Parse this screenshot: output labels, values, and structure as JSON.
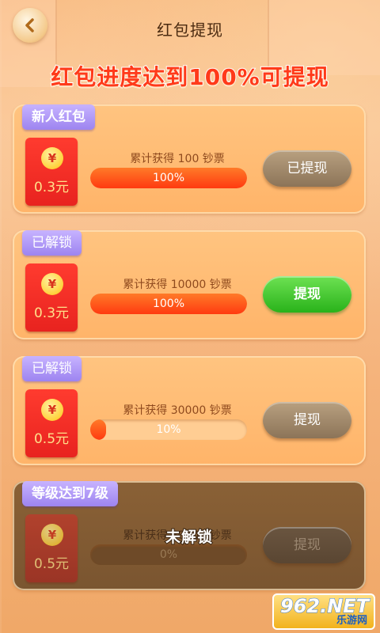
{
  "header": {
    "title": "红包提现",
    "headline": "红包进度达到100%可提现"
  },
  "cards": [
    {
      "tag": "新人红包",
      "coin": "¥",
      "amount": "0.3元",
      "goal": "累计获得 100 钞票",
      "progress": 1.0,
      "progress_text": "100%",
      "button": "已提现",
      "state": "withdrawn"
    },
    {
      "tag": "已解锁",
      "coin": "¥",
      "amount": "0.3元",
      "goal": "累计获得 10000 钞票",
      "progress": 1.0,
      "progress_text": "100%",
      "button": "提现",
      "state": "available"
    },
    {
      "tag": "已解锁",
      "coin": "¥",
      "amount": "0.5元",
      "goal": "累计获得 30000 钞票",
      "progress": 0.1,
      "progress_text": "10%",
      "button": "提现",
      "state": "in_progress"
    },
    {
      "tag": "等级达到7级",
      "coin": "¥",
      "amount": "0.5元",
      "goal": "累计获得 50000 钞票",
      "progress": 0.0,
      "progress_text": "0%",
      "button": "提现",
      "state": "locked",
      "lock_text": "未解锁"
    }
  ],
  "watermark": {
    "big": "962.NET",
    "small": "乐游网"
  },
  "colors": {
    "headline": "#ff3a1a",
    "active_button": "#29b21a",
    "progress": "#ff3a10",
    "tag": "#9d84f0"
  }
}
